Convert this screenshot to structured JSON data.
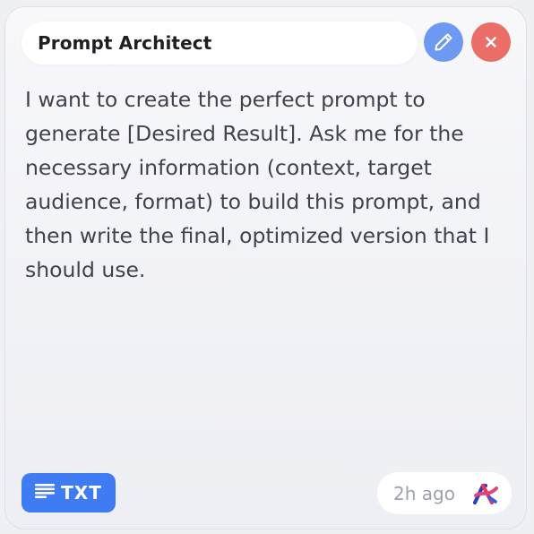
{
  "card": {
    "title": "Prompt Architect",
    "body": "I want to create the perfect prompt to generate [Desired Result]. Ask me for the necessary information (context, target audience, format) to build this prompt, and then write the final, optimized version that I should use.",
    "format_badge": "TXT",
    "timestamp": "2h ago"
  },
  "icons": {
    "edit": "pencil-icon",
    "close": "close-icon",
    "format": "text-lines-icon",
    "logo": "app-logo-icon"
  },
  "colors": {
    "edit_button": "#6e99f2",
    "close_button": "#ea6e67",
    "badge": "#3f7cf4",
    "body_text": "#3f434d",
    "timestamp": "#9ea2ac"
  }
}
